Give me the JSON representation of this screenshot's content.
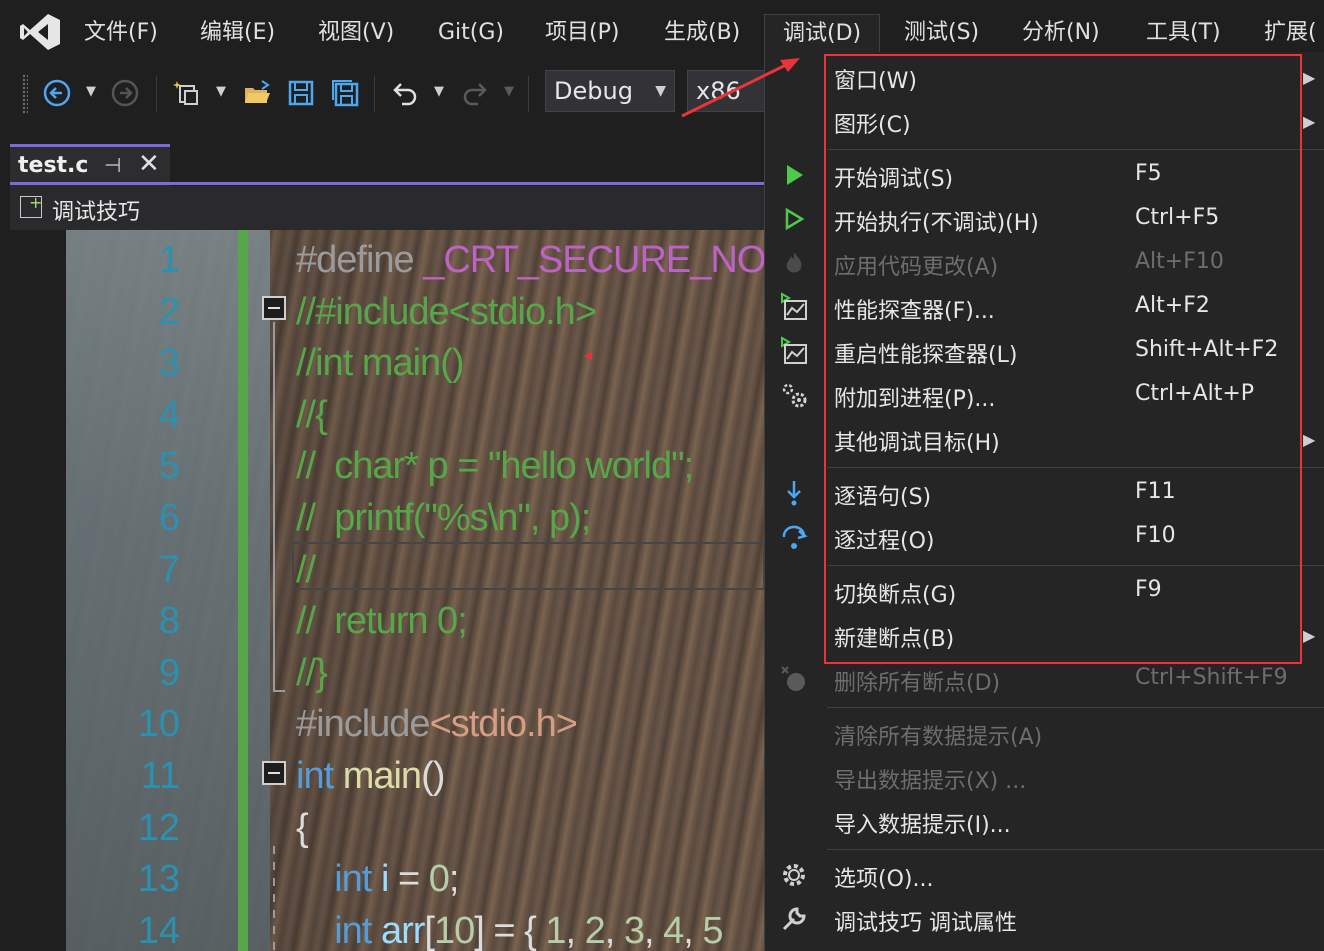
{
  "menubar": {
    "items": [
      "文件(F)",
      "编辑(E)",
      "视图(V)",
      "Git(G)",
      "项目(P)",
      "生成(B)",
      "调试(D)",
      "测试(S)",
      "分析(N)",
      "工具(T)",
      "扩展("
    ],
    "active_index": 6
  },
  "toolbar": {
    "config": "Debug",
    "platform": "x86"
  },
  "tab": {
    "title": "test.c"
  },
  "navbar": {
    "scope": "调试技巧"
  },
  "editor": {
    "line_numbers": [
      "1",
      "2",
      "3",
      "4",
      "5",
      "6",
      "7",
      "8",
      "9",
      "10",
      "11",
      "12",
      "13",
      "14"
    ],
    "lines": [
      [
        {
          "t": "#define ",
          "c": "pre"
        },
        {
          "t": "_CRT_SECURE_NO_",
          "c": "macro"
        }
      ],
      [
        {
          "t": "//#include<stdio.h>",
          "c": "comment"
        }
      ],
      [
        {
          "t": "//int main()",
          "c": "comment"
        }
      ],
      [
        {
          "t": "//{",
          "c": "comment"
        }
      ],
      [
        {
          "t": "//  char* p = \"hello world\";",
          "c": "comment"
        }
      ],
      [
        {
          "t": "//  printf(\"%s\\n\", p);",
          "c": "comment"
        }
      ],
      [
        {
          "t": "//",
          "c": "comment"
        }
      ],
      [
        {
          "t": "//  return 0;",
          "c": "comment"
        }
      ],
      [
        {
          "t": "//}",
          "c": "comment"
        }
      ],
      [
        {
          "t": "#include",
          "c": "pre"
        },
        {
          "t": "<stdio.h>",
          "c": "str"
        }
      ],
      [
        {
          "t": "int",
          "c": "kw"
        },
        {
          "t": " ",
          "c": "plain"
        },
        {
          "t": "main",
          "c": "fn"
        },
        {
          "t": "()",
          "c": "plain"
        }
      ],
      [
        {
          "t": "{",
          "c": "plain"
        }
      ],
      [
        {
          "t": "    ",
          "c": "plain"
        },
        {
          "t": "int",
          "c": "kw"
        },
        {
          "t": " ",
          "c": "plain"
        },
        {
          "t": "i",
          "c": "var"
        },
        {
          "t": " = ",
          "c": "plain"
        },
        {
          "t": "0",
          "c": "num"
        },
        {
          "t": ";",
          "c": "plain"
        }
      ],
      [
        {
          "t": "    ",
          "c": "plain"
        },
        {
          "t": "int",
          "c": "kw"
        },
        {
          "t": " ",
          "c": "plain"
        },
        {
          "t": "arr",
          "c": "var"
        },
        {
          "t": "[",
          "c": "plain"
        },
        {
          "t": "10",
          "c": "num"
        },
        {
          "t": "] = { ",
          "c": "plain"
        },
        {
          "t": "1",
          "c": "num"
        },
        {
          "t": ", ",
          "c": "plain"
        },
        {
          "t": "2",
          "c": "num"
        },
        {
          "t": ", ",
          "c": "plain"
        },
        {
          "t": "3",
          "c": "num"
        },
        {
          "t": ", ",
          "c": "plain"
        },
        {
          "t": "4",
          "c": "num"
        },
        {
          "t": ", ",
          "c": "plain"
        },
        {
          "t": "5",
          "c": "num"
        }
      ]
    ]
  },
  "debug_menu": {
    "items": [
      {
        "label": "窗口(W)",
        "shortcut": "",
        "icon": "",
        "submenu": true,
        "disabled": false
      },
      {
        "label": "图形(C)",
        "shortcut": "",
        "icon": "",
        "submenu": true,
        "disabled": false
      },
      {
        "sep": true
      },
      {
        "label": "开始调试(S)",
        "shortcut": "F5",
        "icon": "play-filled-icon",
        "submenu": false,
        "disabled": false
      },
      {
        "label": "开始执行(不调试)(H)",
        "shortcut": "Ctrl+F5",
        "icon": "play-outline-icon",
        "submenu": false,
        "disabled": false
      },
      {
        "label": "应用代码更改(A)",
        "shortcut": "Alt+F10",
        "icon": "flame-icon",
        "submenu": false,
        "disabled": true
      },
      {
        "label": "性能探查器(F)...",
        "shortcut": "Alt+F2",
        "icon": "profiler-icon",
        "submenu": false,
        "disabled": false
      },
      {
        "label": "重启性能探查器(L)",
        "shortcut": "Shift+Alt+F2",
        "icon": "profiler-restart-icon",
        "submenu": false,
        "disabled": false
      },
      {
        "label": "附加到进程(P)...",
        "shortcut": "Ctrl+Alt+P",
        "icon": "gears-icon",
        "submenu": false,
        "disabled": false
      },
      {
        "label": "其他调试目标(H)",
        "shortcut": "",
        "icon": "",
        "submenu": true,
        "disabled": false
      },
      {
        "sep": true
      },
      {
        "label": "逐语句(S)",
        "shortcut": "F11",
        "icon": "step-into-icon",
        "submenu": false,
        "disabled": false
      },
      {
        "label": "逐过程(O)",
        "shortcut": "F10",
        "icon": "step-over-icon",
        "submenu": false,
        "disabled": false
      },
      {
        "sep": true
      },
      {
        "label": "切换断点(G)",
        "shortcut": "F9",
        "icon": "",
        "submenu": false,
        "disabled": false
      },
      {
        "label": "新建断点(B)",
        "shortcut": "",
        "icon": "",
        "submenu": true,
        "disabled": false
      },
      {
        "label": "删除所有断点(D)",
        "shortcut": "Ctrl+Shift+F9",
        "icon": "delete-breakpoints-icon",
        "submenu": false,
        "disabled": true
      },
      {
        "sep": true
      },
      {
        "label": "清除所有数据提示(A)",
        "shortcut": "",
        "icon": "",
        "submenu": false,
        "disabled": true
      },
      {
        "label": "导出数据提示(X) ...",
        "shortcut": "",
        "icon": "",
        "submenu": false,
        "disabled": true
      },
      {
        "label": "导入数据提示(I)...",
        "shortcut": "",
        "icon": "",
        "submenu": false,
        "disabled": false
      },
      {
        "sep": true
      },
      {
        "label": "选项(O)...",
        "shortcut": "",
        "icon": "gear-icon",
        "submenu": false,
        "disabled": false
      },
      {
        "label": "调试技巧 调试属性",
        "shortcut": "",
        "icon": "wrench-icon",
        "submenu": false,
        "disabled": false
      }
    ]
  },
  "colors": {
    "accent": "#7c6cd9",
    "annotation": "#e8343a",
    "change_bar": "#57a64a"
  }
}
